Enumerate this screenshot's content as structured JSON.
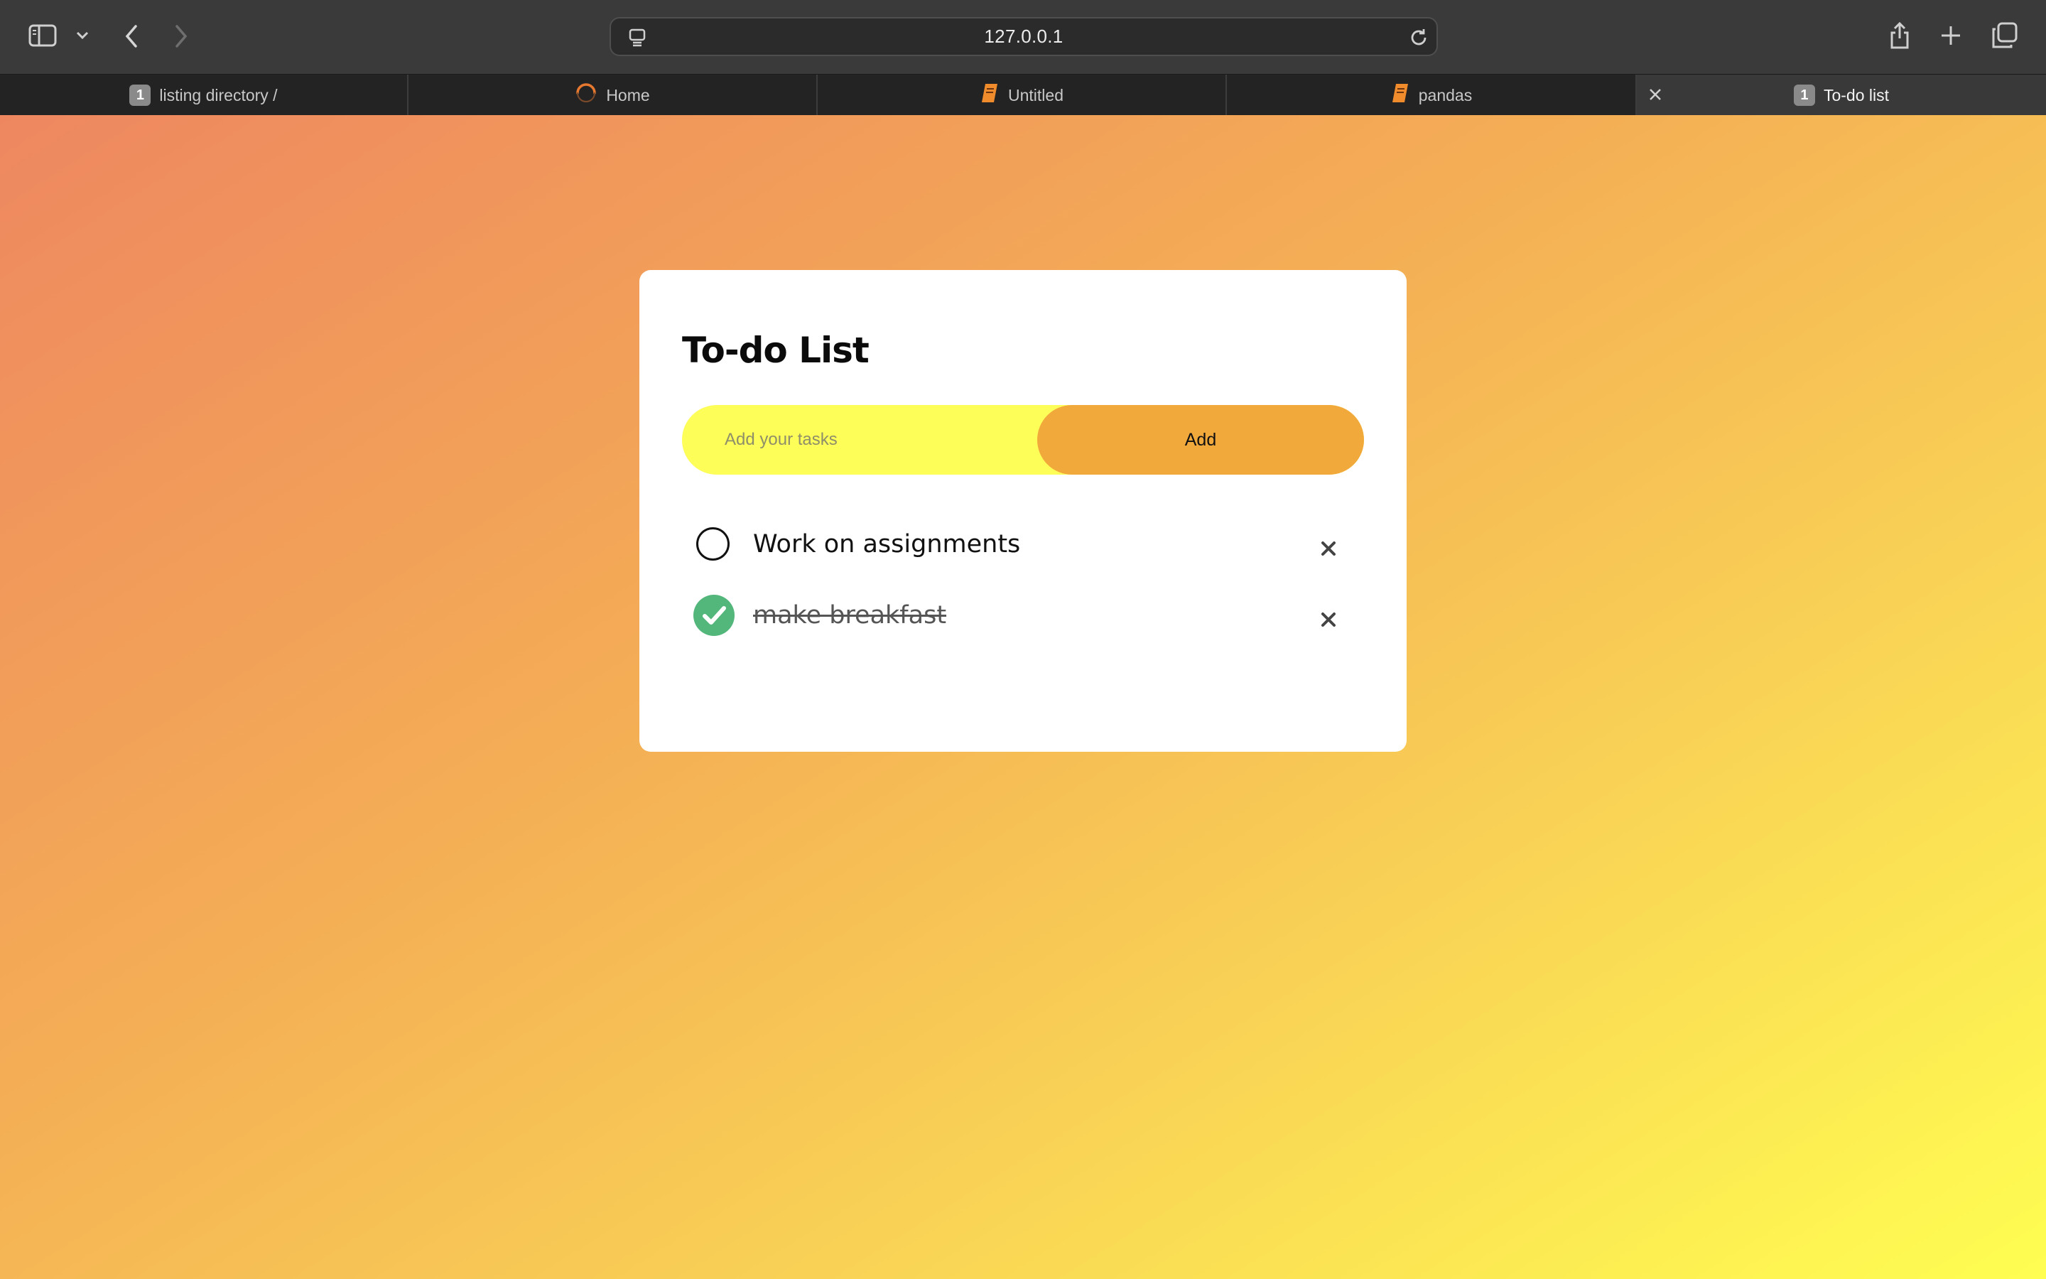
{
  "browser": {
    "url": "127.0.0.1",
    "tabs": [
      {
        "label": "listing directory /",
        "badge": "1",
        "icon": "badge-icon"
      },
      {
        "label": "Home",
        "icon": "spinner-icon"
      },
      {
        "label": "Untitled",
        "icon": "notebook-icon"
      },
      {
        "label": "pandas",
        "icon": "notebook-icon"
      },
      {
        "label": "To-do list",
        "badge": "1",
        "icon": "badge-icon",
        "active": true
      }
    ]
  },
  "app": {
    "title": "To-do List",
    "input": {
      "placeholder": "Add your tasks",
      "value": ""
    },
    "add_button": "Add",
    "tasks": [
      {
        "text": "Work on assignments",
        "done": false
      },
      {
        "text": "make breakfast",
        "done": true
      }
    ]
  },
  "colors": {
    "accent": "#f2a93c",
    "input_bg": "#fefe58",
    "check_done": "#53b67b",
    "gradient_start": "#ee8760",
    "gradient_end": "#fffe51"
  }
}
